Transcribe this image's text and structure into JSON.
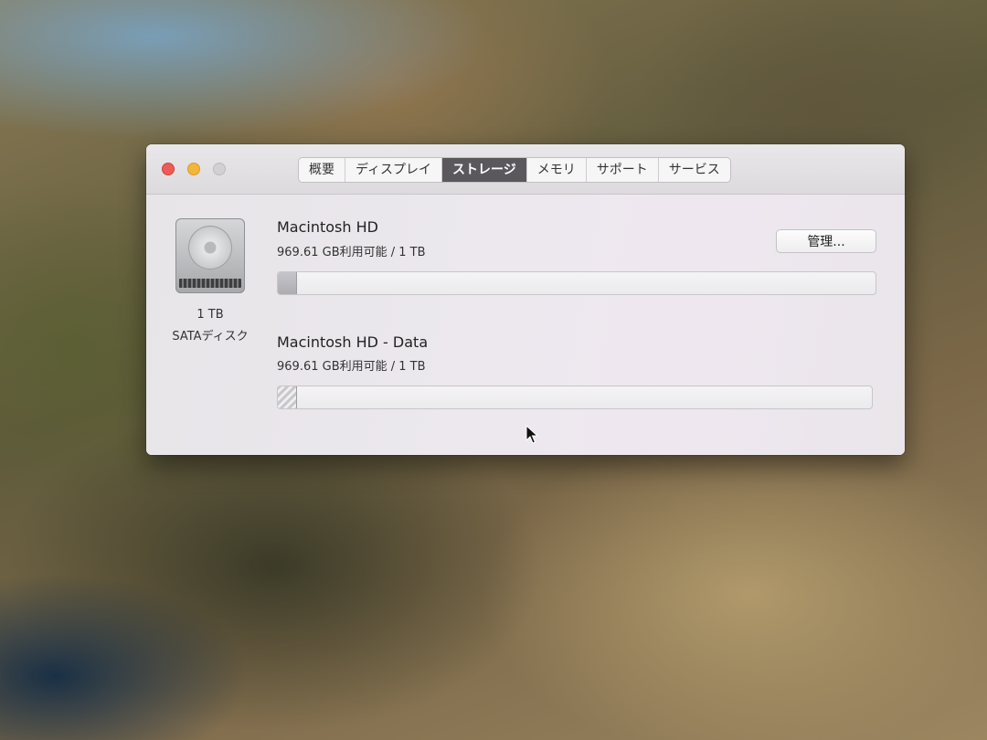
{
  "window": {
    "tabs": [
      {
        "label": "概要",
        "active": false
      },
      {
        "label": "ディスプレイ",
        "active": false
      },
      {
        "label": "ストレージ",
        "active": true
      },
      {
        "label": "メモリ",
        "active": false
      },
      {
        "label": "サポート",
        "active": false
      },
      {
        "label": "サービス",
        "active": false
      }
    ]
  },
  "disk": {
    "icon": "hard-drive-icon",
    "capacity": "1 TB",
    "type": "SATAディスク"
  },
  "volumes": [
    {
      "name": "Macintosh HD",
      "info": "969.61 GB利用可能 / 1 TB",
      "used_fraction": 0.03,
      "fill_style": "solid"
    },
    {
      "name": "Macintosh HD - Data",
      "info": "969.61 GB利用可能 / 1 TB",
      "used_fraction": 0.03,
      "fill_style": "striped"
    }
  ],
  "manage_button": {
    "label": "管理..."
  },
  "colors": {
    "close": "#ee5b57",
    "minimize": "#f3b63a",
    "zoom_disabled": "#d2d0d2",
    "active_tab": "#5a585c"
  }
}
